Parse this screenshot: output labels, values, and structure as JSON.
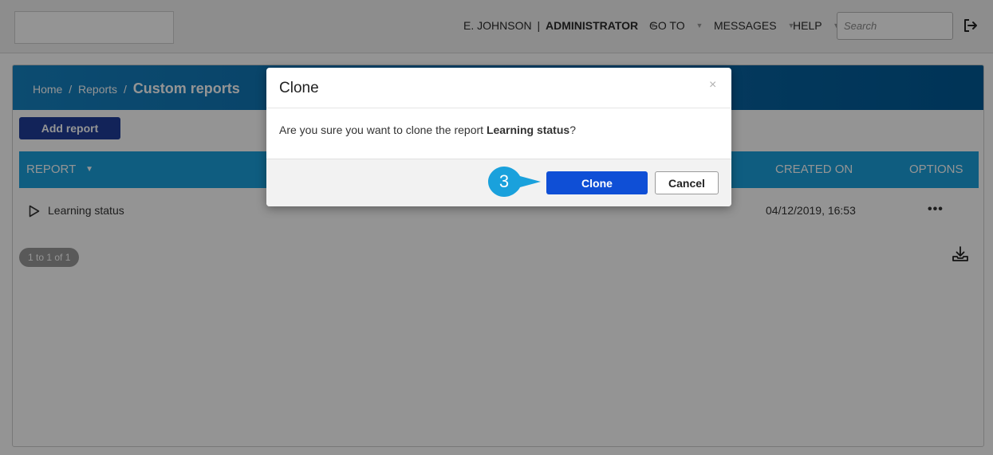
{
  "topbar": {
    "user_name": "E. JOHNSON",
    "user_sep": "|",
    "user_role": "ADMINISTRATOR",
    "goto": "GO TO",
    "messages": "MESSAGES",
    "help": "HELP",
    "search_placeholder": "Search"
  },
  "breadcrumb": {
    "home": "Home",
    "sep": "/",
    "reports": "Reports",
    "current": "Custom reports"
  },
  "toolbar": {
    "add_report": "Add report"
  },
  "table": {
    "columns": {
      "report": "REPORT",
      "created_on": "CREATED ON",
      "options": "OPTIONS"
    },
    "rows": [
      {
        "name": "Learning status",
        "created_on": "04/12/2019, 16:53",
        "options": "•••"
      }
    ],
    "pager": "1 to 1 of 1"
  },
  "modal": {
    "title": "Clone",
    "close": "×",
    "body_prefix": "Are you sure you want to clone the report ",
    "body_report": "Learning status",
    "body_suffix": "?",
    "confirm": "Clone",
    "cancel": "Cancel"
  },
  "step_marker": {
    "number": "3",
    "color": "#1aa1dc"
  },
  "colors": {
    "header_blue": "#0c68a8",
    "table_head": "#1aa1dc",
    "add_button": "#1f3d99",
    "clone_button": "#0f4fd6"
  }
}
